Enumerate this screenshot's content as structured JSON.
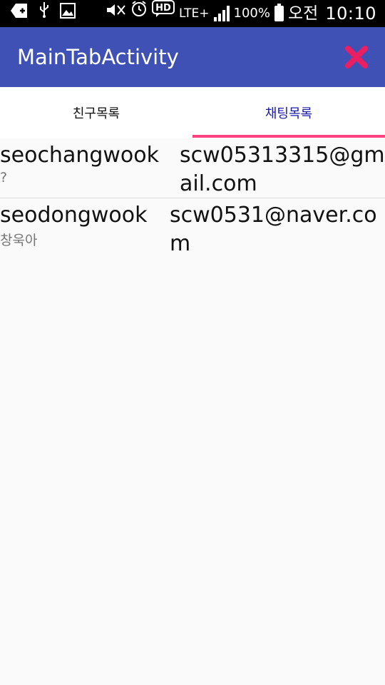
{
  "status_bar": {
    "battery": "100%",
    "ampm": "오전",
    "time": "10:10",
    "network": "LTE+",
    "hd": "HD"
  },
  "app_bar": {
    "title": "MainTabActivity",
    "close_color": "#e91e63"
  },
  "tabs": [
    {
      "label": "친구목록",
      "selected": false
    },
    {
      "label": "채팅목록",
      "selected": true
    }
  ],
  "rows": [
    {
      "name": "seochangwook",
      "status": "?",
      "email": "scw05313315@gmail.com"
    },
    {
      "name": "seodongwook",
      "status": "창욱아",
      "email": "scw0531@naver.com"
    }
  ],
  "colors": {
    "app_bar": "#3f51b5",
    "tab_indicator": "#ff4081",
    "selected_tab_text": "#1a1aa8"
  }
}
